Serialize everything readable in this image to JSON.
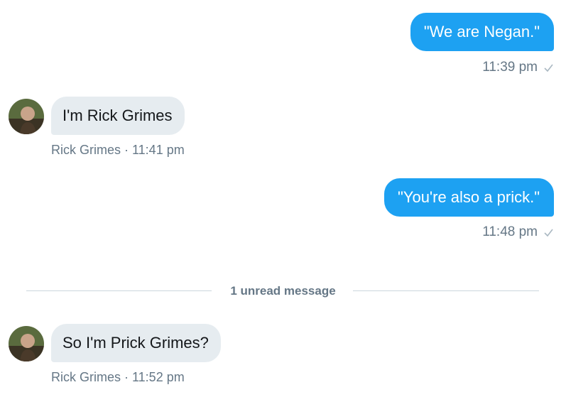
{
  "messages": [
    {
      "direction": "outgoing",
      "text": "\"We are Negan.\"",
      "time": "11:39 pm"
    },
    {
      "direction": "incoming",
      "text": "I'm Rick Grimes",
      "meta": "Rick Grimes · 11:41 pm"
    },
    {
      "direction": "outgoing",
      "text": "\"You're also a prick.\"",
      "time": "11:48 pm"
    },
    {
      "direction": "incoming",
      "text": "So I'm Prick Grimes?",
      "meta": "Rick Grimes · 11:52 pm"
    }
  ],
  "unread_divider": {
    "label": "1 unread message"
  },
  "colors": {
    "outgoing_bubble": "#1da1f2",
    "incoming_bubble": "#e6ecf0",
    "meta_text": "#657786",
    "divider": "#ccd6dd"
  },
  "icons": {
    "read_receipt": "check-icon"
  }
}
